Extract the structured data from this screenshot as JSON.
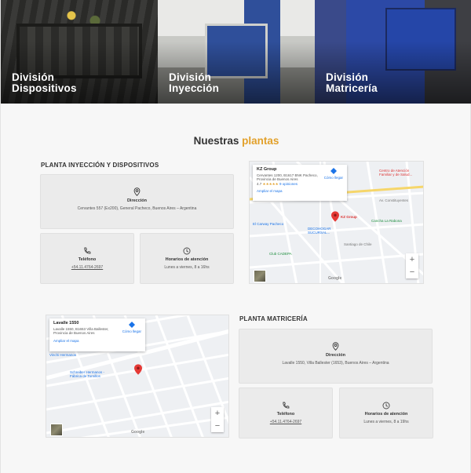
{
  "divisions": [
    {
      "title": "División\nDispositivos"
    },
    {
      "title": "División\nInyección"
    },
    {
      "title": "División\nMatricería"
    }
  ],
  "section": {
    "title_plain": "Nuestras",
    "title_accent": "plantas",
    "accent_color": "#e2a02a"
  },
  "plant1": {
    "title": "PLANTA INYECCIÓN Y DISPOSITIVOS",
    "address_label": "Dirección",
    "address": "Cervantes 557 (Ex200), General Pacheco, Buenos Aires – Argentina",
    "phone_label": "Teléfono",
    "phone": "+54.11.4764-2697",
    "hours_label": "Horarios de atención",
    "hours": "Lunes a viernes, 8 a 16hs",
    "map": {
      "place_name": "KZ Group",
      "place_address": "Cervantes 1200, B1617 BNK Pacheco, Provincia de Buenos Aires",
      "rating": "4.7",
      "stars": "★★★★★",
      "reviews": "9 opiniones",
      "larger_map": "Ampliar el mapa",
      "directions": "Cómo llegar",
      "pin_label": "KZ Group",
      "pois": [
        "Centro de Atención Familiar y de Salud...",
        "Cancha La Rabona",
        "DECOHOGAR SUCURSAL...",
        "Club CADEPA",
        "El Carway Pacheco"
      ],
      "streets": [
        "Av. Constituyentes",
        "Santiago del Estero",
        "Santiago de Chile",
        "Ombú",
        "Cervantes",
        "25 de Julio"
      ],
      "google": "Google"
    }
  },
  "plant2": {
    "title": "PLANTA MATRICERÍA",
    "address_label": "Dirección",
    "address": "Lavalle 1550, Villa Ballester (1653), Buenos Aires – Argentina",
    "phone_label": "Teléfono",
    "phone": "+54.11.4764-2697",
    "hours_label": "Horarios de atención",
    "hours": "Lunes a viernes, 8 a 19hs",
    "map": {
      "place_name": "Lavalle 1550",
      "place_address": "Lavalle 1550, B1653 Villa Ballester, Provincia de Buenos Aires",
      "larger_map": "Ampliar el mapa",
      "directions": "Cómo llegar",
      "pois": [
        "Vinchi Hermanos",
        "Schreiber Hermanos - Fábrica de Tornillos"
      ],
      "streets": [
        "Lavalle",
        "Gral. Roca",
        "Saavedra",
        "Vicente López",
        "Belgrano"
      ],
      "google": "Google"
    }
  },
  "icons": {
    "location": "location-pin-icon",
    "phone": "phone-icon",
    "clock": "clock-icon"
  }
}
